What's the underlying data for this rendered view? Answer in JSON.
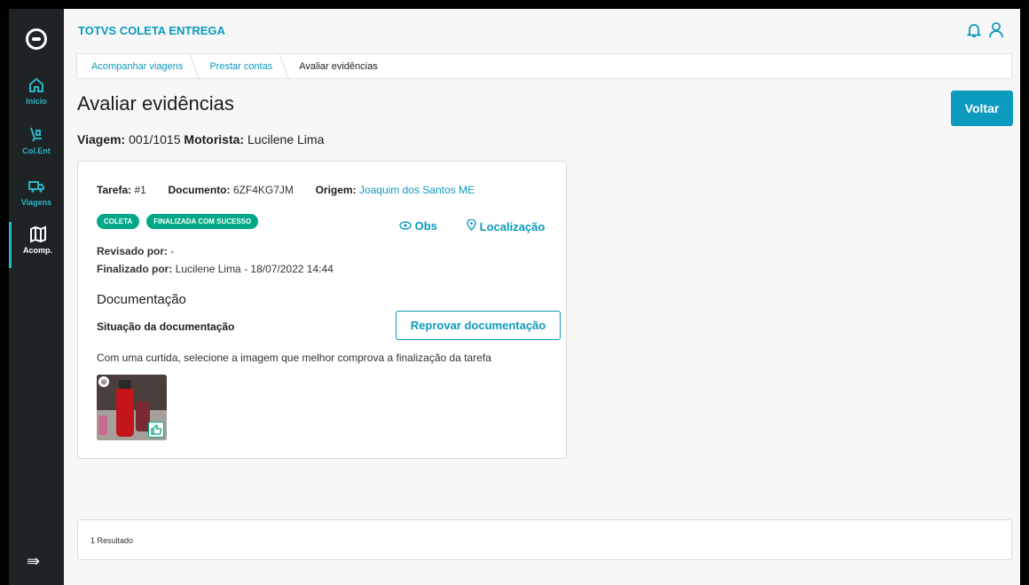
{
  "header": {
    "app_title": "TOTVS COLETA ENTREGA"
  },
  "sidebar": {
    "items": [
      {
        "label": "Início",
        "icon": "home-icon"
      },
      {
        "label": "Col.Ent",
        "icon": "trolley-icon"
      },
      {
        "label": "Viagens",
        "icon": "truck-icon"
      },
      {
        "label": "Acomp.",
        "icon": "map-icon"
      }
    ]
  },
  "breadcrumb": [
    "Acompanhar viagens",
    "Prestar contas",
    "Avaliar evidências"
  ],
  "page": {
    "title": "Avaliar evidências",
    "back_label": "Voltar",
    "trip_label": "Viagem:",
    "trip_value": "001/1015",
    "driver_label": "Motorista:",
    "driver_value": "Lucilene Lima"
  },
  "card": {
    "task_label": "Tarefa:",
    "task_value": "#1",
    "doc_label": "Documento:",
    "doc_value": "6ZF4KG7JM",
    "origin_label": "Origem:",
    "origin_value": "Joaquim dos Santos ME",
    "tags": [
      "COLETA",
      "FINALIZADA COM SUCESSO"
    ],
    "obs_label": "Obs",
    "location_label": "Localização",
    "reviewed_label": "Revisado por:",
    "reviewed_value": "-",
    "finished_label": "Finalizado por:",
    "finished_value": "Lucilene Lima - 18/07/2022 14:44",
    "documentation_title": "Documentação",
    "doc_status_label": "Situação da documentação",
    "reject_label": "Reprovar documentação",
    "instruction": "Com uma curtida, selecione a imagem que melhor comprova a finalização da tarefa"
  },
  "footer": {
    "results": "1 Resultado"
  },
  "colors": {
    "accent": "#0c9abe",
    "success": "#00a887",
    "sidebar": "#1e2326"
  }
}
